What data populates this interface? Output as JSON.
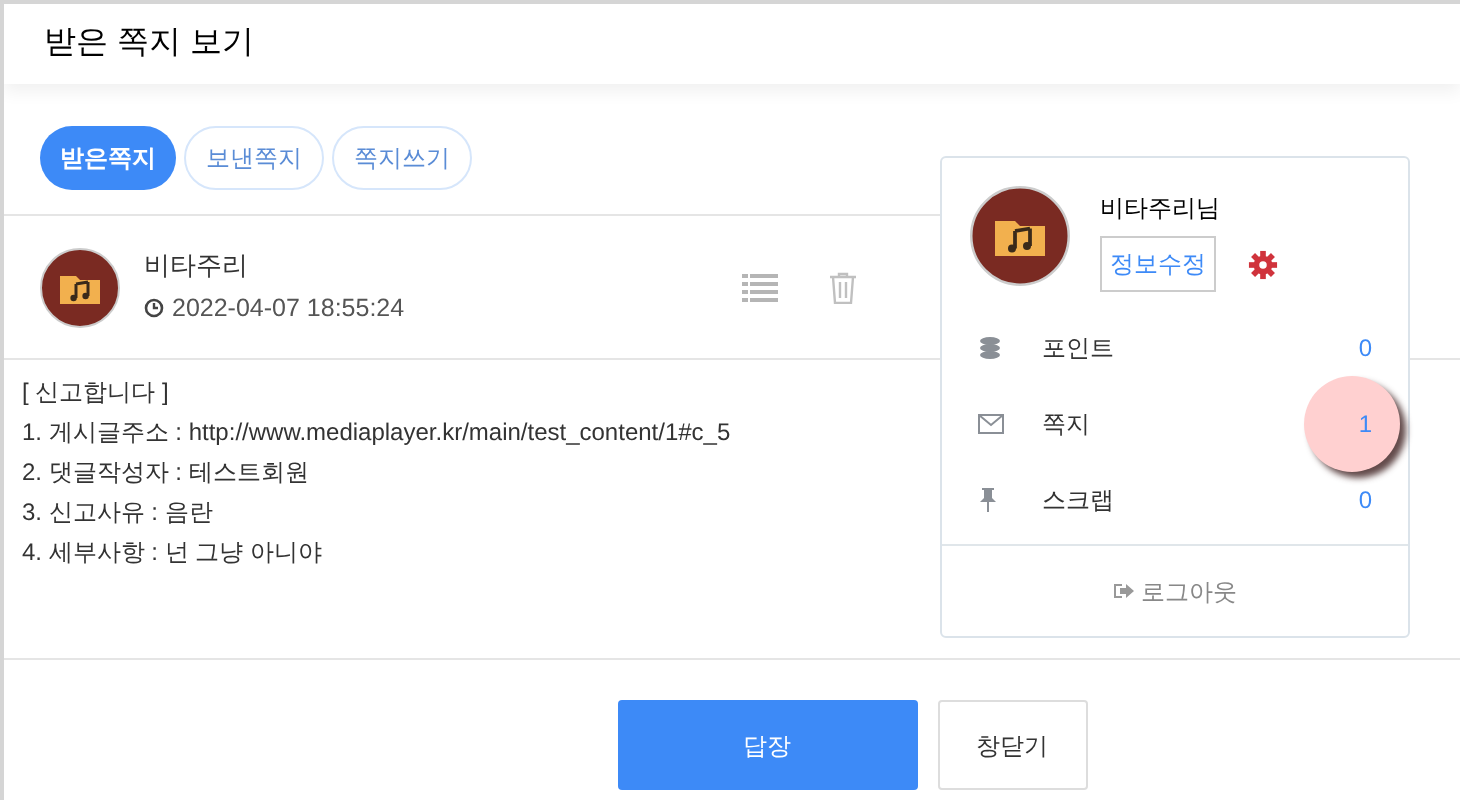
{
  "title": "받은 쪽지 보기",
  "tabs": [
    {
      "label": "받은쪽지",
      "selected": true
    },
    {
      "label": "보낸쪽지",
      "selected": false
    },
    {
      "label": "쪽지쓰기",
      "selected": false
    }
  ],
  "message": {
    "sender": "비타주리",
    "time": "2022-04-07 18:55:24",
    "lines": [
      "[ 신고합니다 ]",
      "1. 게시글주소 : http://www.mediaplayer.kr/main/test_content/1#c_5",
      "2. 댓글작성자 : 테스트회원",
      "3. 신고사유 : 음란",
      "4. 세부사항 : 넌 그냥 아니야"
    ]
  },
  "buttons": [
    "답장",
    "창닫기"
  ],
  "profile": {
    "name": "비타주리님",
    "edit_button": "정보수정",
    "items": [
      {
        "kind": "points",
        "label": "포인트",
        "count": "0",
        "highlighted": false
      },
      {
        "kind": "messages",
        "label": "쪽지",
        "count": "1",
        "highlighted": true
      },
      {
        "kind": "scrap",
        "label": "스크랩",
        "count": "0",
        "highlighted": false
      }
    ],
    "logout": "로그아웃"
  }
}
